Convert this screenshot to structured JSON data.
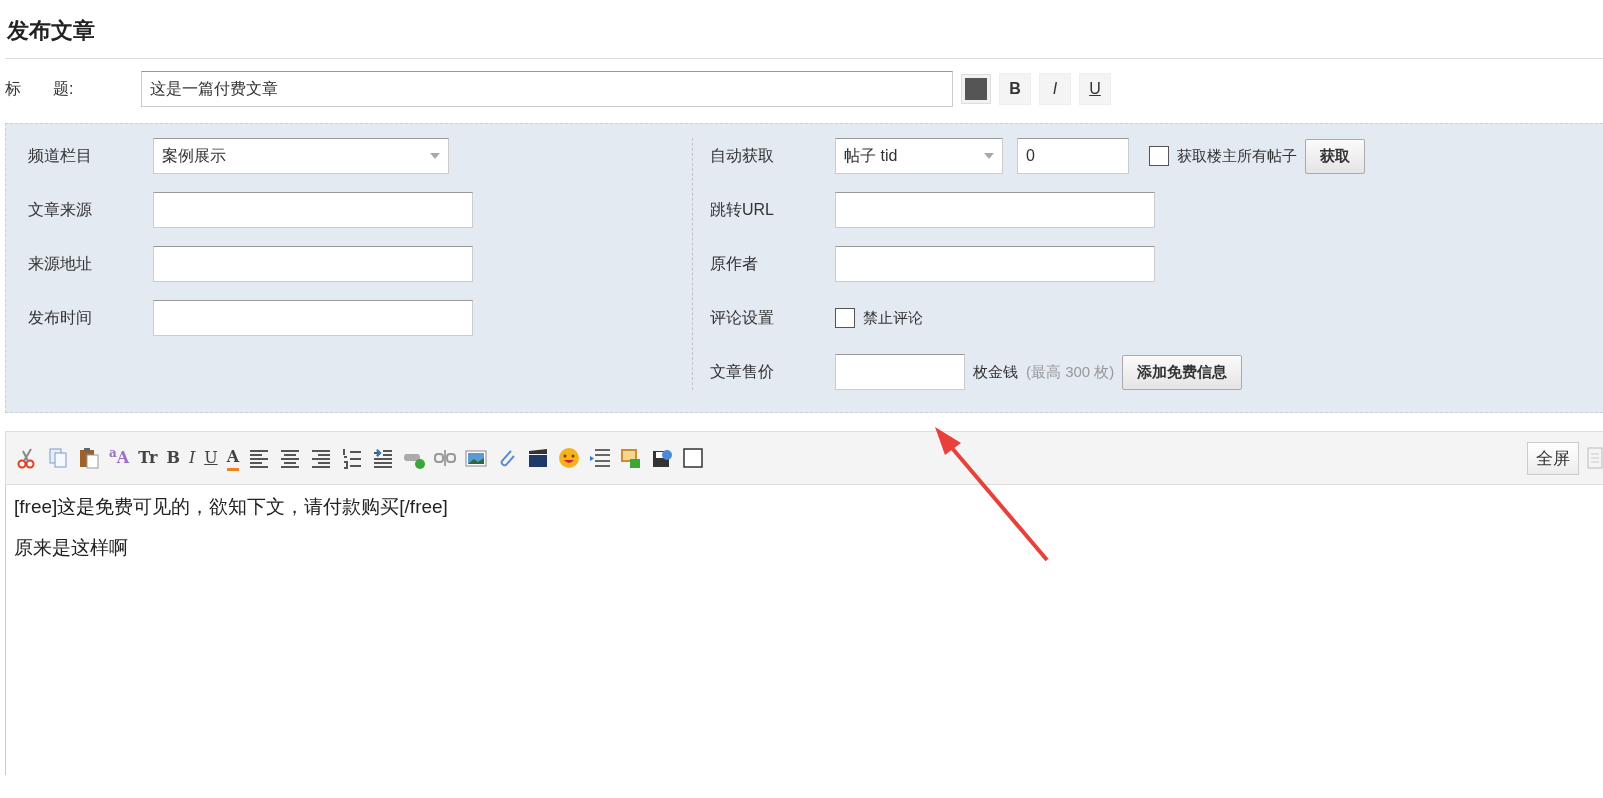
{
  "page_title": "发布文章",
  "title_field": {
    "label": "标　　题:",
    "value": "这是一篇付费文章"
  },
  "title_style": [
    {
      "kind": "color",
      "color": "#555555"
    },
    {
      "kind": "bold",
      "text": "B"
    },
    {
      "kind": "italic",
      "text": "I"
    },
    {
      "kind": "underline",
      "text": "U"
    }
  ],
  "left_fields": [
    {
      "label": "频道栏目",
      "kind": "select",
      "value": "案例展示"
    },
    {
      "label": "文章来源",
      "kind": "text"
    },
    {
      "label": "来源地址",
      "kind": "text"
    },
    {
      "label": "发布时间",
      "kind": "text"
    }
  ],
  "right_fields": [
    {
      "label": "自动获取",
      "kind": "fetch",
      "select": "帖子 tid",
      "value": "0",
      "checkbox": {
        "label": "获取楼主所有帖子",
        "checked": false
      },
      "button": "获取"
    },
    {
      "label": "跳转URL",
      "kind": "text"
    },
    {
      "label": "原作者",
      "kind": "text"
    },
    {
      "label": "评论设置",
      "kind": "checkbox",
      "checkbox": {
        "label": "禁止评论",
        "checked": false
      }
    },
    {
      "label": "文章售价",
      "kind": "price",
      "unit": "枚金钱",
      "hint": "(最高 300 枚)",
      "button": "添加免费信息"
    }
  ],
  "toolbar": [
    {
      "kind": "cut"
    },
    {
      "kind": "copy"
    },
    {
      "kind": "paste"
    },
    {
      "kind": "font",
      "text": "$^{a}$A"
    },
    {
      "kind": "size",
      "text": "Tr"
    },
    {
      "kind": "bold",
      "text": "B"
    },
    {
      "kind": "italic",
      "text": "I"
    },
    {
      "kind": "underline",
      "text": "U"
    },
    {
      "kind": "forecolor",
      "text": "A"
    },
    {
      "kind": "align-left"
    },
    {
      "kind": "align-center"
    },
    {
      "kind": "align-right"
    },
    {
      "kind": "ordered-list"
    },
    {
      "kind": "indent"
    },
    {
      "kind": "link"
    },
    {
      "kind": "unlink"
    },
    {
      "kind": "image"
    },
    {
      "kind": "attach"
    },
    {
      "kind": "video"
    },
    {
      "kind": "smiley"
    },
    {
      "kind": "page-break"
    },
    {
      "kind": "insert-image"
    },
    {
      "kind": "save"
    },
    {
      "kind": "checkbox"
    }
  ],
  "fullscreen_button": "全屏",
  "editor_lines": [
    "[free]这是免费可见的，欲知下文，请付款购买[/free]",
    "原来是这样啊"
  ]
}
